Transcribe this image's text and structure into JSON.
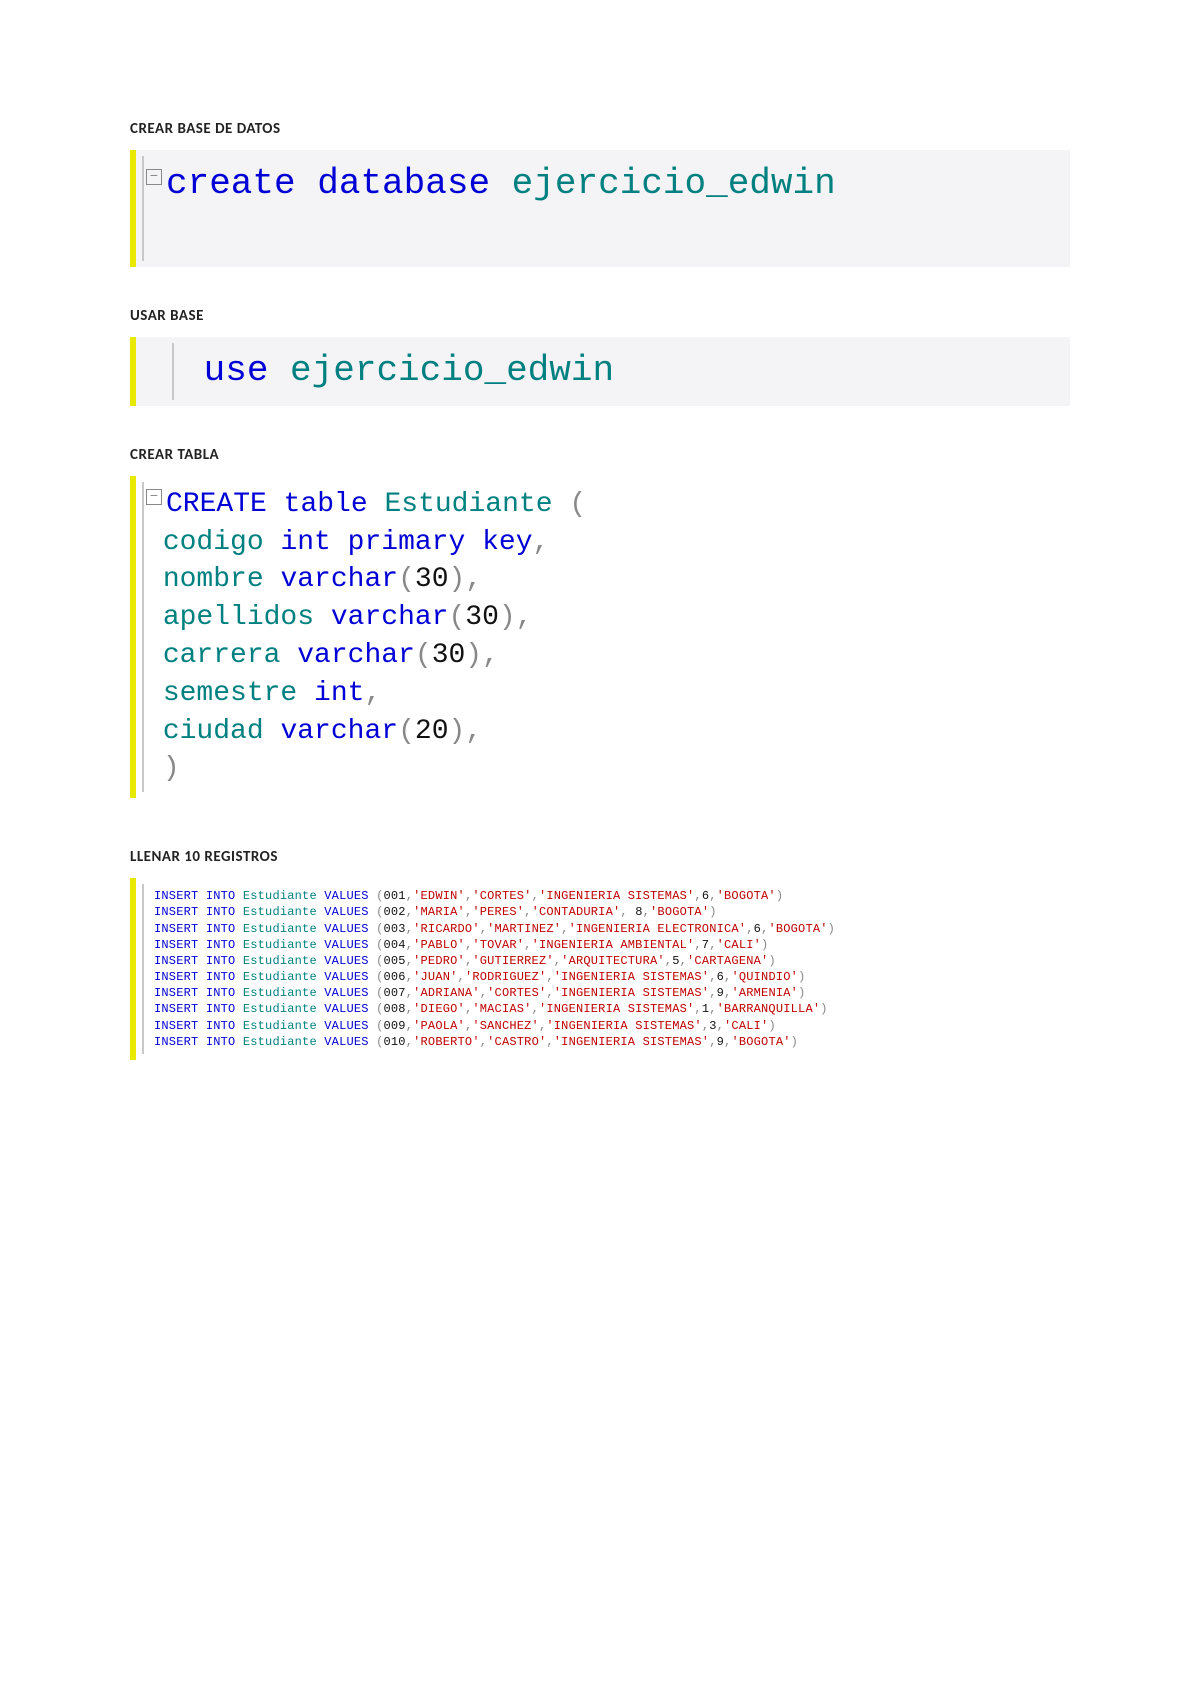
{
  "headings": {
    "h1": "CREAR BASE DE DATOS",
    "h2": "USAR BASE",
    "h3": "CREAR TABLA",
    "h4": "LLENAR 10 REGISTROS"
  },
  "block1": {
    "kw1": "create",
    "kw2": "database",
    "name": "ejercicio_edwin"
  },
  "block2": {
    "kw1": "use",
    "name": "ejercicio_edwin"
  },
  "block3": {
    "kw_create": "CREATE",
    "kw_table": "table",
    "tbl": "Estudiante",
    "paren_open": "(",
    "cols": {
      "c1_name": "codigo",
      "c1_type": "int primary key",
      "c2_name": "nombre",
      "c2_type": "varchar",
      "c2_size": "30",
      "c3_name": "apellidos",
      "c3_type": "varchar",
      "c3_size": "30",
      "c4_name": "carrera",
      "c4_type": "varchar",
      "c4_size": "30",
      "c5_name": "semestre",
      "c5_type": "int",
      "c6_name": "ciudad",
      "c6_type": "varchar",
      "c6_size": "20"
    },
    "comma": ",",
    "paren_close": ")"
  },
  "block4": {
    "kw_insert": "INSERT",
    "kw_into": "INTO",
    "tbl": "Estudiante",
    "kw_values": "VALUES",
    "rows": [
      {
        "id": "001",
        "nom": "'EDWIN'",
        "ap": "'CORTES'",
        "car": "'INGENIERIA SISTEMAS'",
        "sem": "6",
        "ciu": "'BOGOTA'"
      },
      {
        "id": "002",
        "nom": "'MARIA'",
        "ap": "'PERES'",
        "car": "'CONTADURIA'",
        "sem": " 8",
        "ciu": "'BOGOTA'"
      },
      {
        "id": "003",
        "nom": "'RICARDO'",
        "ap": "'MARTINEZ'",
        "car": "'INGENIERIA ELECTRONICA'",
        "sem": "6",
        "ciu": "'BOGOTA'"
      },
      {
        "id": "004",
        "nom": "'PABLO'",
        "ap": "'TOVAR'",
        "car": "'INGENIERIA AMBIENTAL'",
        "sem": "7",
        "ciu": "'CALI'"
      },
      {
        "id": "005",
        "nom": "'PEDRO'",
        "ap": "'GUTIERREZ'",
        "car": "'ARQUITECTURA'",
        "sem": "5",
        "ciu": "'CARTAGENA'"
      },
      {
        "id": "006",
        "nom": "'JUAN'",
        "ap": "'RODRIGUEZ'",
        "car": "'INGENIERIA SISTEMAS'",
        "sem": "6",
        "ciu": "'QUINDIO'"
      },
      {
        "id": "007",
        "nom": "'ADRIANA'",
        "ap": "'CORTES'",
        "car": "'INGENIERIA SISTEMAS'",
        "sem": "9",
        "ciu": "'ARMENIA'"
      },
      {
        "id": "008",
        "nom": "'DIEGO'",
        "ap": "'MACIAS'",
        "car": "'INGENIERIA SISTEMAS'",
        "sem": "1",
        "ciu": "'BARRANQUILLA'"
      },
      {
        "id": "009",
        "nom": "'PAOLA'",
        "ap": "'SANCHEZ'",
        "car": "'INGENIERIA SISTEMAS'",
        "sem": "3",
        "ciu": "'CALI'"
      },
      {
        "id": "010",
        "nom": "'ROBERTO'",
        "ap": "'CASTRO'",
        "car": "'INGENIERIA SISTEMAS'",
        "sem": "9",
        "ciu": "'BOGOTA'"
      }
    ]
  }
}
